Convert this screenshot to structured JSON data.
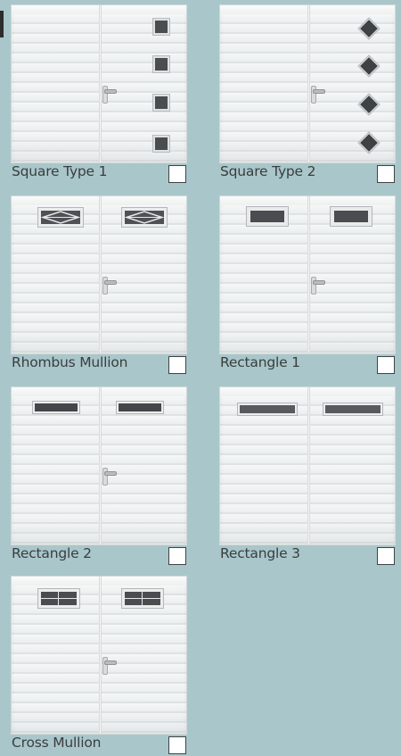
{
  "options": [
    {
      "label": "Square Type 1",
      "window": "square",
      "checked": false
    },
    {
      "label": "Square Type 2",
      "window": "diamond",
      "checked": false
    },
    {
      "label": "Rhombus Mullion",
      "window": "rhombus",
      "checked": false
    },
    {
      "label": "Rectangle 1",
      "window": "rect1",
      "checked": false
    },
    {
      "label": "Rectangle 2",
      "window": "rect2",
      "checked": false
    },
    {
      "label": "Rectangle 3",
      "window": "rect3",
      "checked": false
    },
    {
      "label": "Cross Mullion",
      "window": "cross",
      "checked": false
    }
  ],
  "colors": {
    "background": "#a9c7ca",
    "door_panel": "#f2f4f4",
    "window_glass": "#4a4d50",
    "label_text": "#3b3d3f"
  }
}
